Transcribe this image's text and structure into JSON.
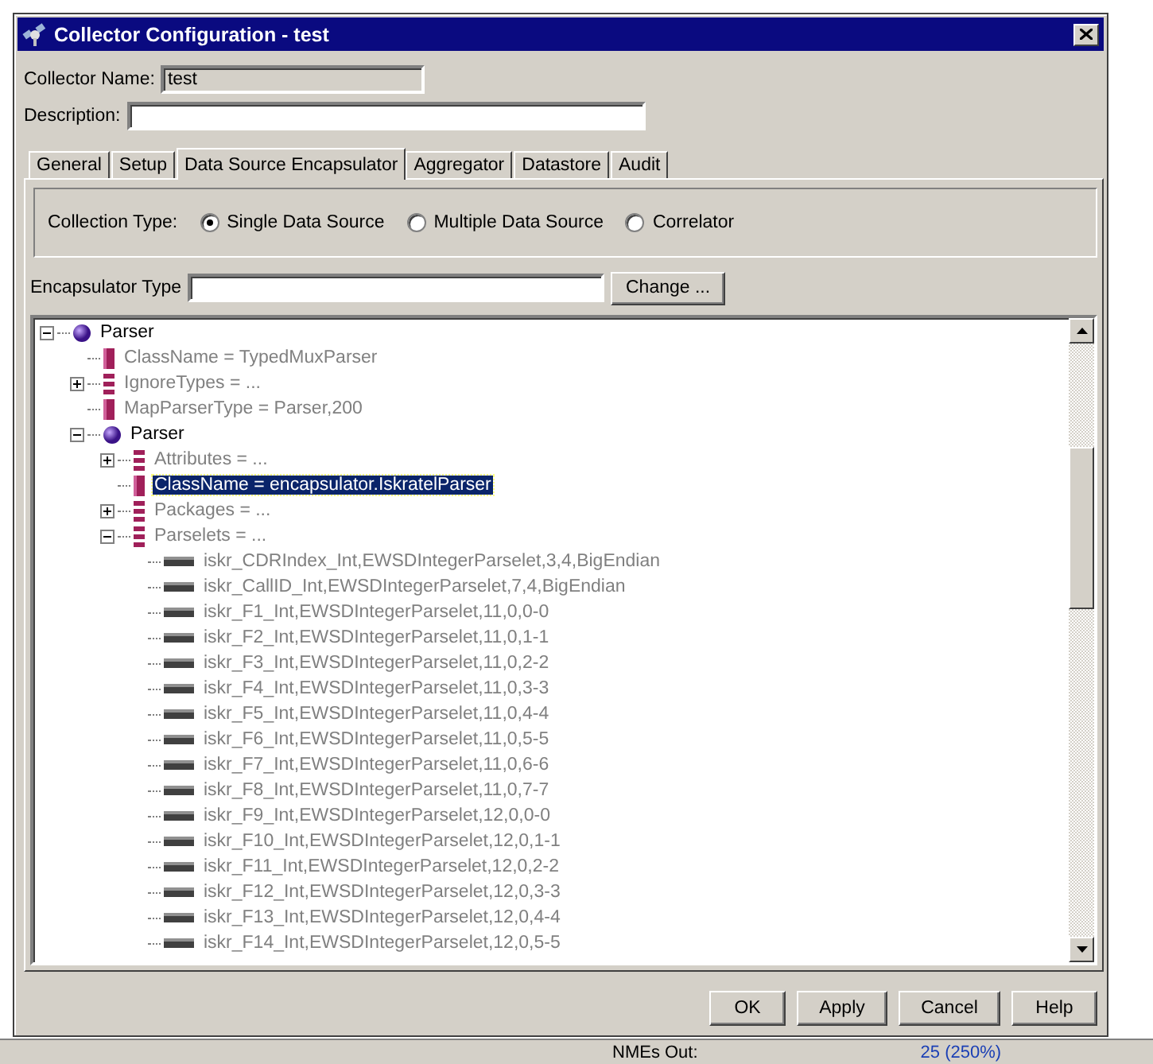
{
  "window": {
    "title": "Collector Configuration - test"
  },
  "collector_name": {
    "label": "Collector Name:",
    "value": "test"
  },
  "description": {
    "label": "Description:"
  },
  "tabs": [
    {
      "label": "General",
      "selected": false
    },
    {
      "label": "Setup",
      "selected": false
    },
    {
      "label": "Data Source Encapsulator",
      "selected": true
    },
    {
      "label": "Aggregator",
      "selected": false
    },
    {
      "label": "Datastore",
      "selected": false
    },
    {
      "label": "Audit",
      "selected": false
    }
  ],
  "collection_type": {
    "label": "Collection Type:",
    "options": [
      {
        "label": "Single Data Source",
        "selected": true
      },
      {
        "label": "Multiple Data Source",
        "selected": false
      },
      {
        "label": "Correlator",
        "selected": false
      }
    ]
  },
  "encapsulator_type": {
    "label": "Encapsulator Type",
    "button": "Change ..."
  },
  "tree": [
    {
      "label": "Parser",
      "kind": "node",
      "expanded": true,
      "selected": false,
      "children": [
        {
          "label": "ClassName = TypedMuxParser",
          "kind": "attribute",
          "selected": false
        },
        {
          "label": "IgnoreTypes = ...",
          "kind": "list",
          "expanded": false,
          "selected": false
        },
        {
          "label": "MapParserType = Parser,200",
          "kind": "attribute",
          "selected": false
        },
        {
          "label": "Parser",
          "kind": "node",
          "expanded": true,
          "selected": false,
          "children": [
            {
              "label": "Attributes = ...",
              "kind": "list",
              "expanded": false,
              "selected": false
            },
            {
              "label": "ClassName = encapsulator.IskratelParser",
              "kind": "attribute",
              "selected": true
            },
            {
              "label": "Packages = ...",
              "kind": "list",
              "expanded": false,
              "selected": false
            },
            {
              "label": "Parselets = ...",
              "kind": "list",
              "expanded": true,
              "selected": false,
              "children": [
                {
                  "label": "iskr_CDRIndex_Int,EWSDIntegerParselet,3,4,BigEndian",
                  "kind": "item",
                  "selected": false
                },
                {
                  "label": "iskr_CallID_Int,EWSDIntegerParselet,7,4,BigEndian",
                  "kind": "item",
                  "selected": false
                },
                {
                  "label": "iskr_F1_Int,EWSDIntegerParselet,11,0,0-0",
                  "kind": "item",
                  "selected": false
                },
                {
                  "label": "iskr_F2_Int,EWSDIntegerParselet,11,0,1-1",
                  "kind": "item",
                  "selected": false
                },
                {
                  "label": "iskr_F3_Int,EWSDIntegerParselet,11,0,2-2",
                  "kind": "item",
                  "selected": false
                },
                {
                  "label": "iskr_F4_Int,EWSDIntegerParselet,11,0,3-3",
                  "kind": "item",
                  "selected": false
                },
                {
                  "label": "iskr_F5_Int,EWSDIntegerParselet,11,0,4-4",
                  "kind": "item",
                  "selected": false
                },
                {
                  "label": "iskr_F6_Int,EWSDIntegerParselet,11,0,5-5",
                  "kind": "item",
                  "selected": false
                },
                {
                  "label": "iskr_F7_Int,EWSDIntegerParselet,11,0,6-6",
                  "kind": "item",
                  "selected": false
                },
                {
                  "label": "iskr_F8_Int,EWSDIntegerParselet,11,0,7-7",
                  "kind": "item",
                  "selected": false
                },
                {
                  "label": "iskr_F9_Int,EWSDIntegerParselet,12,0,0-0",
                  "kind": "item",
                  "selected": false
                },
                {
                  "label": "iskr_F10_Int,EWSDIntegerParselet,12,0,1-1",
                  "kind": "item",
                  "selected": false
                },
                {
                  "label": "iskr_F11_Int,EWSDIntegerParselet,12,0,2-2",
                  "kind": "item",
                  "selected": false
                },
                {
                  "label": "iskr_F12_Int,EWSDIntegerParselet,12,0,3-3",
                  "kind": "item",
                  "selected": false
                },
                {
                  "label": "iskr_F13_Int,EWSDIntegerParselet,12,0,4-4",
                  "kind": "item",
                  "selected": false
                },
                {
                  "label": "iskr_F14_Int,EWSDIntegerParselet,12,0,5-5",
                  "kind": "item",
                  "selected": false
                }
              ]
            }
          ]
        }
      ]
    }
  ],
  "buttons": [
    "OK",
    "Apply",
    "Cancel",
    "Help"
  ],
  "background": {
    "label": "NMEs Out:",
    "value": "25 (250%)"
  }
}
